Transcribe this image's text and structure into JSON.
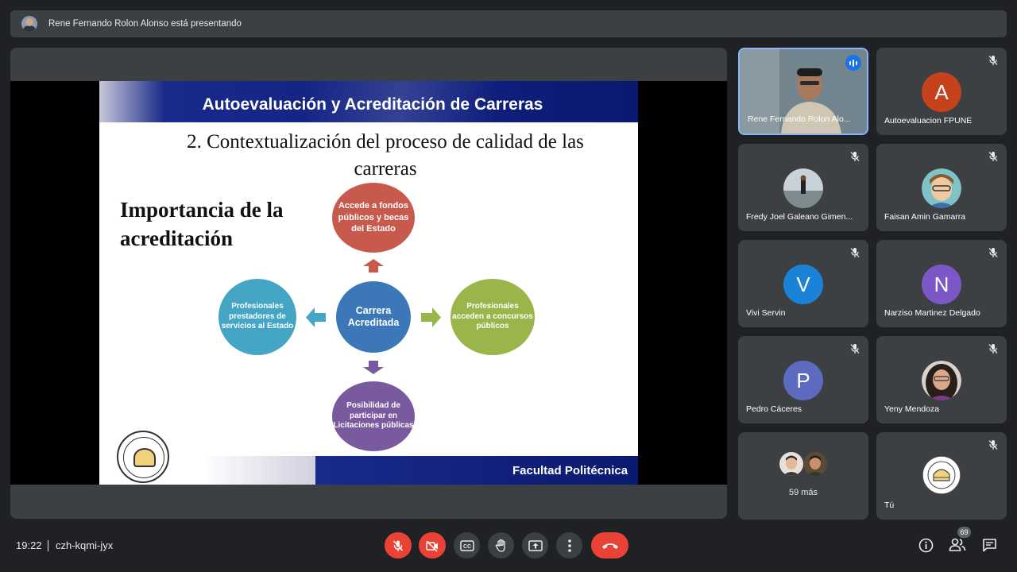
{
  "banner": {
    "text": "Rene Fernando Rolon Alonso está presentando"
  },
  "slide": {
    "header_title": "Autoevaluación y Acreditación de Carreras",
    "subtitle_line1": "2. Contextualización del proceso de calidad de las",
    "subtitle_line2": "carreras",
    "importance_line1": "Importancia de la",
    "importance_line2": "acreditación",
    "center": "Carrera Acreditada",
    "top": "Accede a fondos públicos y becas del Estado",
    "left": "Profesionales prestadores de servicios al Estado",
    "right": "Profesionales acceden a concursos públicos",
    "bottom": "Posibilidad de participar en Licitaciones públicas",
    "footer": "Facultad Politécnica",
    "colors": {
      "top": "#c75a4d",
      "center": "#3c78b8",
      "left": "#44a6c4",
      "right": "#9ab54a",
      "bottom": "#7a5a9e"
    }
  },
  "participants": [
    {
      "name": "Rene Fernando Rolon Alo...",
      "type": "video",
      "speaking": true
    },
    {
      "name": "Autoevaluacion FPUNE",
      "initial": "A",
      "color": "#c5421d",
      "muted": true
    },
    {
      "name": "Fredy Joel Galeano Gimen...",
      "type": "photo",
      "muted": true
    },
    {
      "name": "Faisan Amin Gamarra",
      "type": "photo",
      "muted": true
    },
    {
      "name": "Vivi Servin",
      "initial": "V",
      "color": "#1a83d8",
      "muted": true
    },
    {
      "name": "Narziso Martinez Delgado",
      "initial": "N",
      "color": "#7b57c8",
      "muted": true
    },
    {
      "name": "Pedro Cáceres",
      "initial": "P",
      "color": "#5c6bc0",
      "muted": true
    },
    {
      "name": "Yeny Mendoza",
      "type": "photo",
      "muted": true
    },
    {
      "more": "59 más"
    },
    {
      "name": "Tú",
      "type": "logo",
      "muted": true
    }
  ],
  "bottom_bar": {
    "time": "19:22",
    "meeting_code": "czh-kqmi-jyx",
    "participant_count": "69"
  }
}
